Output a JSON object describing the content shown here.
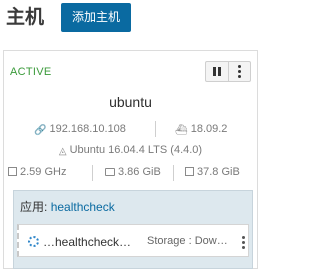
{
  "header": {
    "title": "主机",
    "add_button": "添加主机"
  },
  "host": {
    "state": "ACTIVE",
    "name": "ubuntu",
    "ip": "192.168.10.108",
    "docker_version": "18.09.2",
    "os": "Ubuntu 16.04.4 LTS (4.4.0)",
    "cpu": "2.59 GHz",
    "memory": "3.86 GiB",
    "disk": "37.8 GiB"
  },
  "stack": {
    "label": "应用:",
    "name": "healthcheck",
    "service": {
      "name": "…healthcheck…",
      "image": "Storage : Dow…"
    }
  },
  "icons": {
    "pause": "pause-icon",
    "more": "more-vertical-icon",
    "ip": "link-icon",
    "docker": "docker-icon",
    "os": "os-icon",
    "cpu": "cpu-icon",
    "memory": "memory-icon",
    "disk": "disk-icon",
    "spinner": "spinner-icon"
  },
  "colors": {
    "accent": "#0a6aa1",
    "active": "#3a9a3a",
    "stack_bg": "#dde8ee"
  }
}
